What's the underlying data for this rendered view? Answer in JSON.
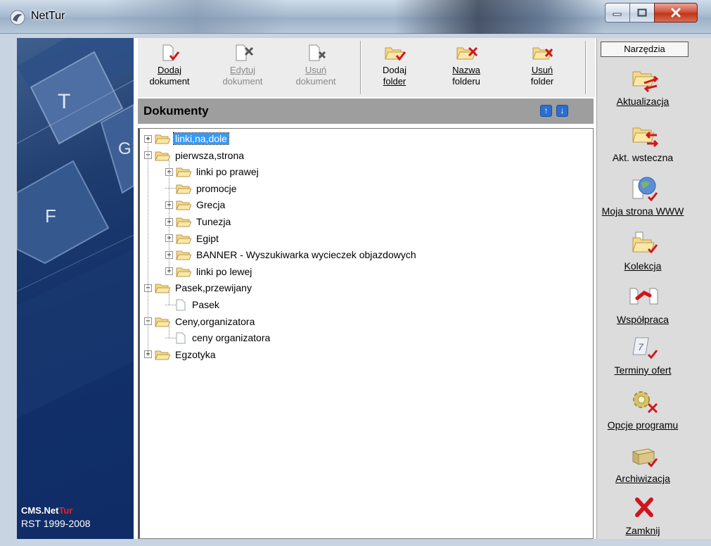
{
  "window": {
    "title": "NetTur",
    "icons": {
      "app": "nettur-app-icon",
      "minimize": "minimize-icon",
      "maximize": "maximize-icon",
      "close": "close-x-icon"
    }
  },
  "banner": {
    "brand_part1": "CMS.Net",
    "brand_part2": "Tur",
    "copyright": "RST 1999-2008",
    "keys": [
      "T",
      "G",
      "F"
    ]
  },
  "toolbar": {
    "add_doc": {
      "line1": "Dodaj",
      "line2": "dokument",
      "icon": "document-check-icon"
    },
    "edit_doc": {
      "line1": "Edytuj",
      "line2": "dokument",
      "icon": "document-tools-icon"
    },
    "delete_doc": {
      "line1": "Usuń",
      "line2": "dokument",
      "icon": "document-delete-icon"
    },
    "add_folder": {
      "line1": "Dodaj",
      "line2": "folder",
      "icon": "folder-check-icon"
    },
    "rename_folder": {
      "line1": "Nazwa",
      "line2": "folderu",
      "icon": "folder-tools-icon"
    },
    "delete_folder": {
      "line1": "Usuń",
      "line2": "folder",
      "icon": "folder-delete-icon"
    }
  },
  "documents": {
    "title": "Dokumenty",
    "up_icon": "arrow-up-icon",
    "down_icon": "arrow-down-icon",
    "tree": [
      {
        "label": "linki,na,dole",
        "type": "folder",
        "expander": "+",
        "selected": true
      },
      {
        "label": "pierwsza,strona",
        "type": "folder",
        "expander": "−"
      },
      {
        "label": "linki po prawej",
        "type": "folder",
        "expander": "+"
      },
      {
        "label": "promocje",
        "type": "folder",
        "expander": ""
      },
      {
        "label": "Grecja",
        "type": "folder",
        "expander": "+"
      },
      {
        "label": "Tunezja",
        "type": "folder",
        "expander": "+"
      },
      {
        "label": "Egipt",
        "type": "folder",
        "expander": "+"
      },
      {
        "label": "BANNER - Wyszukiwarka wycieczek objazdowych",
        "type": "folder",
        "expander": "+"
      },
      {
        "label": "linki po lewej",
        "type": "folder",
        "expander": "+"
      },
      {
        "label": "Pasek,przewijany",
        "type": "folder",
        "expander": "−"
      },
      {
        "label": "Pasek",
        "type": "document",
        "expander": ""
      },
      {
        "label": "Ceny,organizatora",
        "type": "folder",
        "expander": "−"
      },
      {
        "label": "ceny organizatora",
        "type": "document",
        "expander": ""
      },
      {
        "label": "Egzotyka",
        "type": "folder",
        "expander": "+"
      }
    ]
  },
  "tools": {
    "header": "Narzędzia",
    "update": {
      "label": "Aktualizacja",
      "icon": "folder-update-icon"
    },
    "back_update": {
      "label": "Akt. wsteczna",
      "icon": "folder-rollback-icon"
    },
    "website": {
      "label": "Moja strona WWW",
      "icon": "globe-document-icon"
    },
    "collection": {
      "label": "Kolekcja",
      "icon": "folder-collection-icon"
    },
    "cooperation": {
      "label": "Współpraca",
      "icon": "documents-link-icon"
    },
    "offer_dates": {
      "label": "Terminy ofert",
      "icon": "calendar-check-icon"
    },
    "options": {
      "label": "Opcje programu",
      "icon": "gear-tools-icon"
    },
    "archive": {
      "label": "Archiwizacja",
      "icon": "archive-box-icon"
    },
    "close": {
      "label": "Zamknij",
      "icon": "close-red-x-icon"
    }
  },
  "colors": {
    "accent_red": "#e8212a",
    "banner_blue": "#12306a",
    "selection": "#3399ff",
    "arrow_blue": "#2c6fd1"
  }
}
